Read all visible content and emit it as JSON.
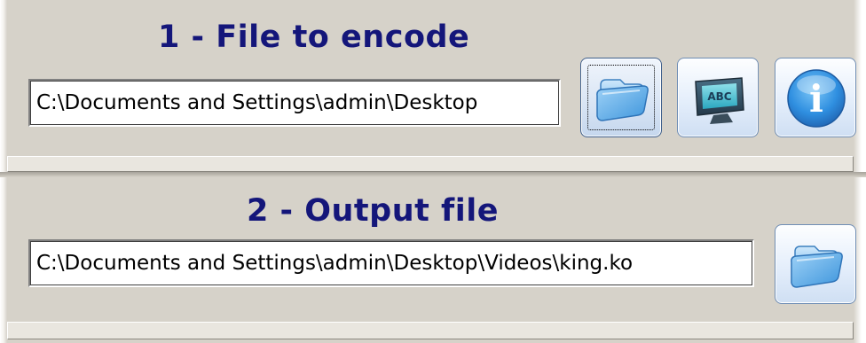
{
  "section1": {
    "heading": "1 - File to encode",
    "input_value": "C:\\Documents and Settings\\admin\\Desktop"
  },
  "section2": {
    "heading": "2 - Output file",
    "input_value": "C:\\Documents and Settings\\admin\\Desktop\\Videos\\king.ko"
  },
  "buttons": [
    {
      "name": "open-file-button",
      "icon": "folder-icon"
    },
    {
      "name": "subtitles-button",
      "icon": "abc-monitor-icon",
      "icon_text": "ABC"
    },
    {
      "name": "info-button",
      "icon": "info-icon",
      "icon_text": "i"
    },
    {
      "name": "output-folder-button",
      "icon": "folder-icon"
    }
  ],
  "colors": {
    "background": "#d6d2c9",
    "heading": "#14167a",
    "button_border": "#6e8db5",
    "icon_blue": "#2f8fe0"
  }
}
